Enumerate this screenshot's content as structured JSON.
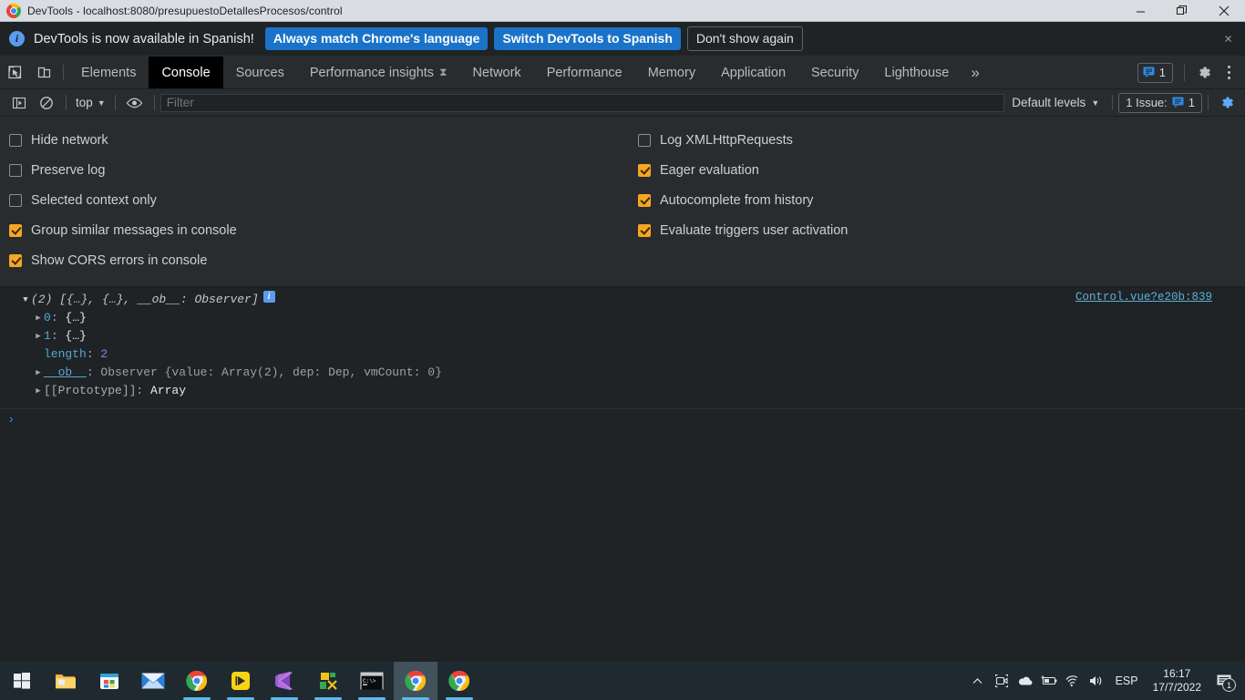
{
  "window": {
    "title": "DevTools - localhost:8080/presupuestoDetallesProcesos/control",
    "favicon": "chrome-icon",
    "minimize_label": "—",
    "restore_label": "❐",
    "close_label": "✕"
  },
  "notification": {
    "icon": "info-icon",
    "text": "DevTools is now available in Spanish!",
    "primary_button": "Always match Chrome's language",
    "secondary_button": "Switch DevTools to Spanish",
    "dismiss_button": "Don't show again",
    "close_label": "×",
    "accent_color": "#1a73c8"
  },
  "tabbar": {
    "inspect_icon": "inspect-cursor-icon",
    "device_icon": "device-toolbar-icon",
    "tabs": [
      {
        "label": "Elements",
        "active": false
      },
      {
        "label": "Console",
        "active": true
      },
      {
        "label": "Sources",
        "active": false
      },
      {
        "label": "Performance insights",
        "active": false,
        "badge": "⧗"
      },
      {
        "label": "Network",
        "active": false
      },
      {
        "label": "Performance",
        "active": false
      },
      {
        "label": "Memory",
        "active": false
      },
      {
        "label": "Application",
        "active": false
      },
      {
        "label": "Security",
        "active": false
      },
      {
        "label": "Lighthouse",
        "active": false
      }
    ],
    "more_label": "»",
    "message_count": "1",
    "message_icon": "message-bubble-icon",
    "settings_icon": "gear-icon",
    "kebab_icon": "more-vertical-icon"
  },
  "console_toolbar": {
    "sidebar_icon": "console-sidebar-icon",
    "clear_icon": "clear-console-icon",
    "context": "top",
    "context_caret": "▼",
    "eye_icon": "live-expression-eye-icon",
    "filter_placeholder": "Filter",
    "filter_value": "",
    "levels_label": "Default levels",
    "levels_caret": "▼",
    "issues_label": "1 Issue:",
    "issues_count": "1",
    "issues_icon": "issues-bubble-icon",
    "settings_icon": "gear-icon-active",
    "settings_active_color": "#5db0ff"
  },
  "settings": {
    "left_options": [
      {
        "label": "Hide network",
        "checked": false
      },
      {
        "label": "Preserve log",
        "checked": false
      },
      {
        "label": "Selected context only",
        "checked": false
      },
      {
        "label": "Group similar messages in console",
        "checked": true
      },
      {
        "label": "Show CORS errors in console",
        "checked": true
      }
    ],
    "right_options": [
      {
        "label": "Log XMLHttpRequests",
        "checked": false
      },
      {
        "label": "Eager evaluation",
        "checked": true
      },
      {
        "label": "Autocomplete from history",
        "checked": true
      },
      {
        "label": "Evaluate triggers user activation",
        "checked": true
      }
    ],
    "checked_color": "#f5a623"
  },
  "console_output": {
    "source_link": "Control.vue?e20b:839",
    "info_badge": "i",
    "header": {
      "arrow": "▼",
      "count": "(2)",
      "summary": "[{…}, {…}, __ob__: Observer]"
    },
    "rows": [
      {
        "arrow": "▶",
        "key": "0",
        "sep": ": ",
        "value": "{…}"
      },
      {
        "arrow": "▶",
        "key": "1",
        "sep": ": ",
        "value": "{…}"
      },
      {
        "arrow": "",
        "key": "length",
        "sep": ": ",
        "value": "2"
      },
      {
        "arrow": "▶",
        "key": "__ob__",
        "sep": ": ",
        "value": "Observer {value: Array(2), dep: Dep, vmCount: 0}"
      },
      {
        "arrow": "▶",
        "key": "[[Prototype]]",
        "sep": ": ",
        "value": "Array"
      }
    ],
    "prompt_caret": "›"
  },
  "taskbar": {
    "items": [
      {
        "name": "start-button",
        "icon": "windows-logo-icon",
        "active": false,
        "running": false
      },
      {
        "name": "file-explorer",
        "icon": "folder-icon",
        "active": false,
        "running": false
      },
      {
        "name": "microsoft-store",
        "icon": "store-icon",
        "active": false,
        "running": false
      },
      {
        "name": "mail",
        "icon": "mail-icon",
        "active": false,
        "running": false
      },
      {
        "name": "chrome-pinned",
        "icon": "chrome-icon",
        "active": false,
        "running": true
      },
      {
        "name": "app-yellow",
        "icon": "play-yellow-icon",
        "active": false,
        "running": true
      },
      {
        "name": "visual-studio",
        "icon": "visual-studio-icon",
        "active": false,
        "running": true
      },
      {
        "name": "app-green",
        "icon": "green-app-icon",
        "active": false,
        "running": true
      },
      {
        "name": "terminal",
        "icon": "terminal-icon",
        "active": false,
        "running": true
      },
      {
        "name": "chrome-devtools-window",
        "icon": "chrome-icon",
        "active": true,
        "running": true
      },
      {
        "name": "chrome-window",
        "icon": "chrome-icon",
        "active": false,
        "running": true
      }
    ],
    "tray": {
      "overflow": "⌃",
      "icons": [
        "camera-icon",
        "onedrive-cloud-icon",
        "battery-charging-icon",
        "wifi-icon",
        "volume-icon"
      ],
      "language": "ESP",
      "time": "16:17",
      "date": "17/7/2022",
      "notification_icon": "action-center-icon",
      "notification_count": "1"
    }
  }
}
